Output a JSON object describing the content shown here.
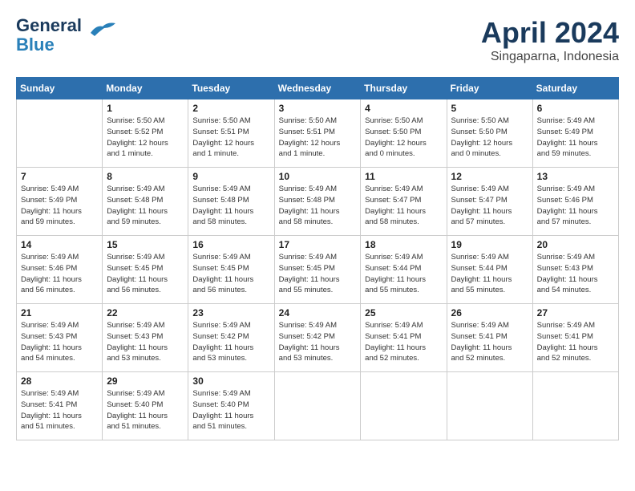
{
  "header": {
    "logo_line1": "General",
    "logo_line2": "Blue",
    "month": "April 2024",
    "location": "Singaparna, Indonesia"
  },
  "weekdays": [
    "Sunday",
    "Monday",
    "Tuesday",
    "Wednesday",
    "Thursday",
    "Friday",
    "Saturday"
  ],
  "weeks": [
    [
      {
        "day": "",
        "info": ""
      },
      {
        "day": "1",
        "info": "Sunrise: 5:50 AM\nSunset: 5:52 PM\nDaylight: 12 hours\nand 1 minute."
      },
      {
        "day": "2",
        "info": "Sunrise: 5:50 AM\nSunset: 5:51 PM\nDaylight: 12 hours\nand 1 minute."
      },
      {
        "day": "3",
        "info": "Sunrise: 5:50 AM\nSunset: 5:51 PM\nDaylight: 12 hours\nand 1 minute."
      },
      {
        "day": "4",
        "info": "Sunrise: 5:50 AM\nSunset: 5:50 PM\nDaylight: 12 hours\nand 0 minutes."
      },
      {
        "day": "5",
        "info": "Sunrise: 5:50 AM\nSunset: 5:50 PM\nDaylight: 12 hours\nand 0 minutes."
      },
      {
        "day": "6",
        "info": "Sunrise: 5:49 AM\nSunset: 5:49 PM\nDaylight: 11 hours\nand 59 minutes."
      }
    ],
    [
      {
        "day": "7",
        "info": "Sunrise: 5:49 AM\nSunset: 5:49 PM\nDaylight: 11 hours\nand 59 minutes."
      },
      {
        "day": "8",
        "info": "Sunrise: 5:49 AM\nSunset: 5:48 PM\nDaylight: 11 hours\nand 59 minutes."
      },
      {
        "day": "9",
        "info": "Sunrise: 5:49 AM\nSunset: 5:48 PM\nDaylight: 11 hours\nand 58 minutes."
      },
      {
        "day": "10",
        "info": "Sunrise: 5:49 AM\nSunset: 5:48 PM\nDaylight: 11 hours\nand 58 minutes."
      },
      {
        "day": "11",
        "info": "Sunrise: 5:49 AM\nSunset: 5:47 PM\nDaylight: 11 hours\nand 58 minutes."
      },
      {
        "day": "12",
        "info": "Sunrise: 5:49 AM\nSunset: 5:47 PM\nDaylight: 11 hours\nand 57 minutes."
      },
      {
        "day": "13",
        "info": "Sunrise: 5:49 AM\nSunset: 5:46 PM\nDaylight: 11 hours\nand 57 minutes."
      }
    ],
    [
      {
        "day": "14",
        "info": "Sunrise: 5:49 AM\nSunset: 5:46 PM\nDaylight: 11 hours\nand 56 minutes."
      },
      {
        "day": "15",
        "info": "Sunrise: 5:49 AM\nSunset: 5:45 PM\nDaylight: 11 hours\nand 56 minutes."
      },
      {
        "day": "16",
        "info": "Sunrise: 5:49 AM\nSunset: 5:45 PM\nDaylight: 11 hours\nand 56 minutes."
      },
      {
        "day": "17",
        "info": "Sunrise: 5:49 AM\nSunset: 5:45 PM\nDaylight: 11 hours\nand 55 minutes."
      },
      {
        "day": "18",
        "info": "Sunrise: 5:49 AM\nSunset: 5:44 PM\nDaylight: 11 hours\nand 55 minutes."
      },
      {
        "day": "19",
        "info": "Sunrise: 5:49 AM\nSunset: 5:44 PM\nDaylight: 11 hours\nand 55 minutes."
      },
      {
        "day": "20",
        "info": "Sunrise: 5:49 AM\nSunset: 5:43 PM\nDaylight: 11 hours\nand 54 minutes."
      }
    ],
    [
      {
        "day": "21",
        "info": "Sunrise: 5:49 AM\nSunset: 5:43 PM\nDaylight: 11 hours\nand 54 minutes."
      },
      {
        "day": "22",
        "info": "Sunrise: 5:49 AM\nSunset: 5:43 PM\nDaylight: 11 hours\nand 53 minutes."
      },
      {
        "day": "23",
        "info": "Sunrise: 5:49 AM\nSunset: 5:42 PM\nDaylight: 11 hours\nand 53 minutes."
      },
      {
        "day": "24",
        "info": "Sunrise: 5:49 AM\nSunset: 5:42 PM\nDaylight: 11 hours\nand 53 minutes."
      },
      {
        "day": "25",
        "info": "Sunrise: 5:49 AM\nSunset: 5:41 PM\nDaylight: 11 hours\nand 52 minutes."
      },
      {
        "day": "26",
        "info": "Sunrise: 5:49 AM\nSunset: 5:41 PM\nDaylight: 11 hours\nand 52 minutes."
      },
      {
        "day": "27",
        "info": "Sunrise: 5:49 AM\nSunset: 5:41 PM\nDaylight: 11 hours\nand 52 minutes."
      }
    ],
    [
      {
        "day": "28",
        "info": "Sunrise: 5:49 AM\nSunset: 5:41 PM\nDaylight: 11 hours\nand 51 minutes."
      },
      {
        "day": "29",
        "info": "Sunrise: 5:49 AM\nSunset: 5:40 PM\nDaylight: 11 hours\nand 51 minutes."
      },
      {
        "day": "30",
        "info": "Sunrise: 5:49 AM\nSunset: 5:40 PM\nDaylight: 11 hours\nand 51 minutes."
      },
      {
        "day": "",
        "info": ""
      },
      {
        "day": "",
        "info": ""
      },
      {
        "day": "",
        "info": ""
      },
      {
        "day": "",
        "info": ""
      }
    ]
  ]
}
